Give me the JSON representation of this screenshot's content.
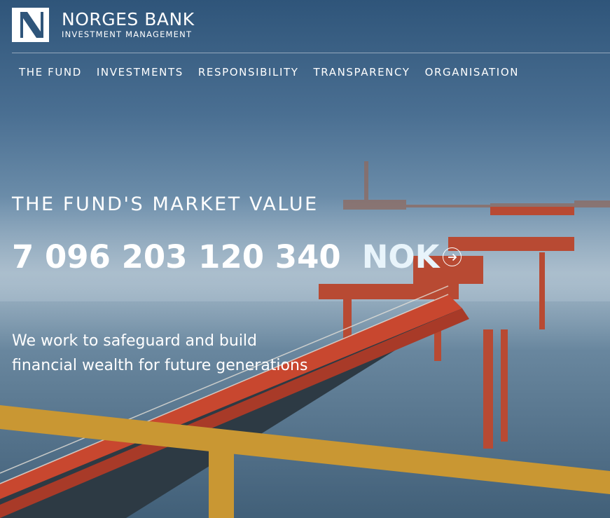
{
  "logo": {
    "title": "NORGES BANK",
    "subtitle": "INVESTMENT MANAGEMENT",
    "mark_icon": "norges-bank-n-logo"
  },
  "nav": {
    "items": [
      {
        "label": "THE FUND"
      },
      {
        "label": "INVESTMENTS"
      },
      {
        "label": "RESPONSIBILITY"
      },
      {
        "label": "TRANSPARENCY"
      },
      {
        "label": "ORGANISATION"
      }
    ]
  },
  "hero": {
    "heading": "THE FUND'S MARKET VALUE",
    "amount": "7 096 203 120 340",
    "currency": "NOK",
    "arrow_icon": "arrow-right-circle-icon",
    "tagline_line1": "We work to safeguard and build",
    "tagline_line2": "financial wealth for future generations"
  },
  "colors": {
    "text": "#ffffff",
    "sky": "#4a6f92",
    "structure": "#c9472e",
    "railing": "#d9a230"
  }
}
